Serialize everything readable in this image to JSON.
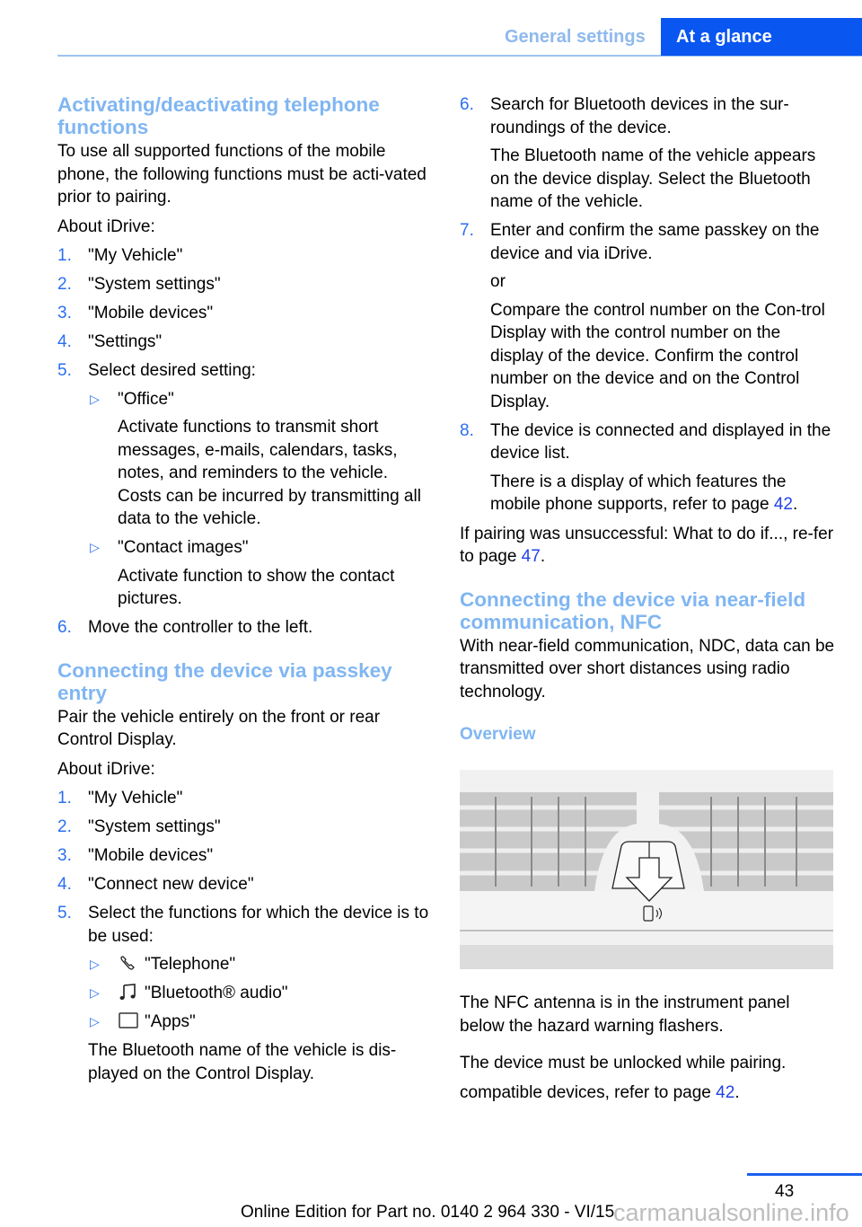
{
  "header": {
    "section": "General settings",
    "chapter": "At a glance"
  },
  "left": {
    "s1": {
      "title": "Activating/deactivating telephone functions",
      "intro": "To use all supported functions of the mobile phone, the following functions must be acti-vated prior to pairing.",
      "about": "About iDrive:",
      "steps": [
        "\"My Vehicle\"",
        "\"System settings\"",
        "\"Mobile devices\"",
        "\"Settings\"",
        "Select desired setting:",
        "Move the controller to the left."
      ],
      "options": [
        {
          "label": "\"Office\"",
          "desc": "Activate functions to transmit short messages, e-mails, calendars, tasks, notes, and reminders to the vehicle. Costs can be incurred by transmitting all data to the vehicle."
        },
        {
          "label": "\"Contact images\"",
          "desc": "Activate function to show the contact pictures."
        }
      ]
    },
    "s2": {
      "title": "Connecting the device via passkey entry",
      "intro": "Pair the vehicle entirely on the front or rear Control Display.",
      "about": "About iDrive:",
      "steps": [
        "\"My Vehicle\"",
        "\"System settings\"",
        "\"Mobile devices\"",
        "\"Connect new device\"",
        "Select the functions for which the device is to be used:"
      ],
      "functions": [
        {
          "icon": "telephone-icon",
          "label": "\"Telephone\""
        },
        {
          "icon": "music-note-icon",
          "label": "\"Bluetooth® audio\""
        },
        {
          "icon": "apps-icon",
          "label": "\"Apps\""
        }
      ],
      "note": "The Bluetooth name of the vehicle is dis-played on the Control Display."
    }
  },
  "right": {
    "step6": {
      "num": "6.",
      "text": "Search for Bluetooth devices in the sur-roundings of the device.",
      "sub": "The Bluetooth name of the vehicle appears on the device display. Select the Bluetooth name of the vehicle."
    },
    "step7": {
      "num": "7.",
      "text": "Enter and confirm the same passkey on the device and via iDrive.",
      "or": "or",
      "sub": "Compare the control number on the Con-trol Display with the control number on the display of the device. Confirm the control number on the device and on the Control Display."
    },
    "step8": {
      "num": "8.",
      "text": "The device is connected and displayed in the device list.",
      "sub": "There is a display of which features the mobile phone supports, refer to page ",
      "sub_link": "42",
      "sub_end": "."
    },
    "unsuccessful": {
      "text": "If pairing was unsuccessful: What to do if..., re-fer to page ",
      "link": "47",
      "end": "."
    },
    "nfc": {
      "title": "Connecting the device via near-field communication, NFC",
      "intro": "With near-field communication, NDC, data can be transmitted over short distances using radio technology.",
      "overview": "Overview",
      "p1": "The NFC antenna is in the instrument panel below the hazard warning flashers.",
      "p2": "The device must be unlocked while pairing.",
      "p3": "compatible devices, refer to page ",
      "p3_link": "42",
      "p3_end": "."
    }
  },
  "footer": {
    "page": "43",
    "edition": "Online Edition for Part no. 0140 2 964 330 - VI/15",
    "watermark": "carmanualsonline.info"
  },
  "colors": {
    "accent": "#0a56f0",
    "heading": "#80b6f2",
    "link": "#2343e8"
  }
}
